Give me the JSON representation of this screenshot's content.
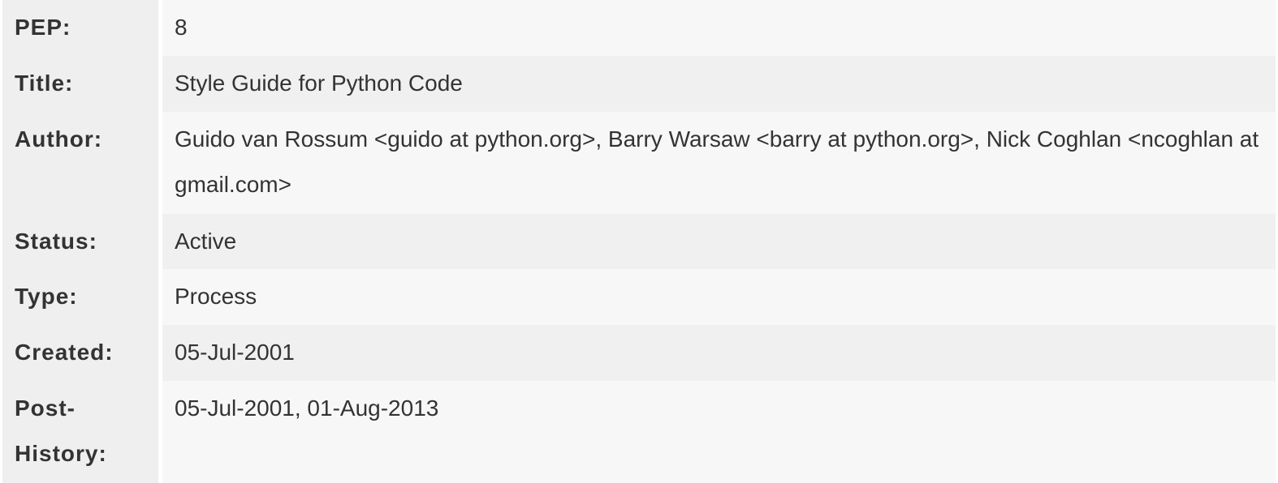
{
  "pep_header": {
    "rows": [
      {
        "label": "PEP:",
        "value": "8"
      },
      {
        "label": "Title:",
        "value": "Style Guide for Python Code"
      },
      {
        "label": "Author:",
        "value": "Guido van Rossum <guido at python.org>, Barry Warsaw <barry at python.org>, Nick Coghlan <ncoghlan at gmail.com>"
      },
      {
        "label": "Status:",
        "value": "Active"
      },
      {
        "label": "Type:",
        "value": "Process"
      },
      {
        "label": "Created:",
        "value": "05-Jul-2001"
      },
      {
        "label": "Post-History:",
        "value": "05-Jul-2001, 01-Aug-2013"
      }
    ]
  }
}
